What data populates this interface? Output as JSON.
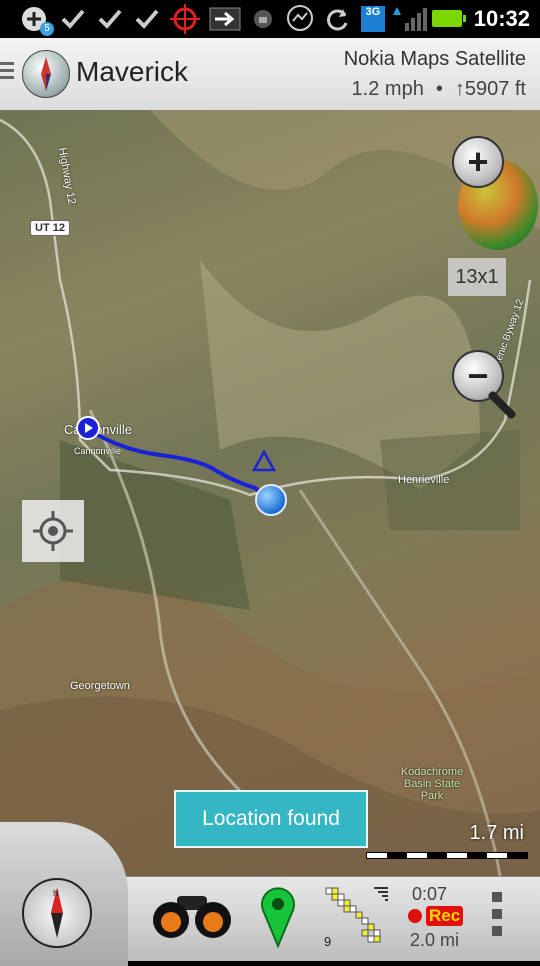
{
  "status_bar": {
    "notification_count": "5",
    "network": "3G",
    "time": "10:32"
  },
  "header": {
    "app_title": "Maverick",
    "map_source": "Nokia Maps Satellite",
    "speed": "1.2 mph",
    "separator": "•",
    "altitude_arrow": "↑",
    "altitude": "5907 ft"
  },
  "map": {
    "labels": {
      "town1": "Cannonville",
      "town1_small": "Cannonville",
      "town2": "Henrieville",
      "town3": "Georgetown",
      "park": "Kodachrome Basin State Park",
      "highway_left": "Highway 12",
      "scenic_byway": "Scenic Byway 12",
      "road_shield": "UT 12"
    },
    "zoom_level": "13x1",
    "toast": "Location found",
    "scale": "1.7 mi"
  },
  "toolbar": {
    "track_time": "0:07",
    "rec_label": "Rec",
    "track_distance": "2.0 mi",
    "satellite_count": "9"
  },
  "colors": {
    "track": "#1a22d8",
    "toast": "#35b6c4",
    "rec": "#e01010",
    "battery": "#7bd700"
  }
}
